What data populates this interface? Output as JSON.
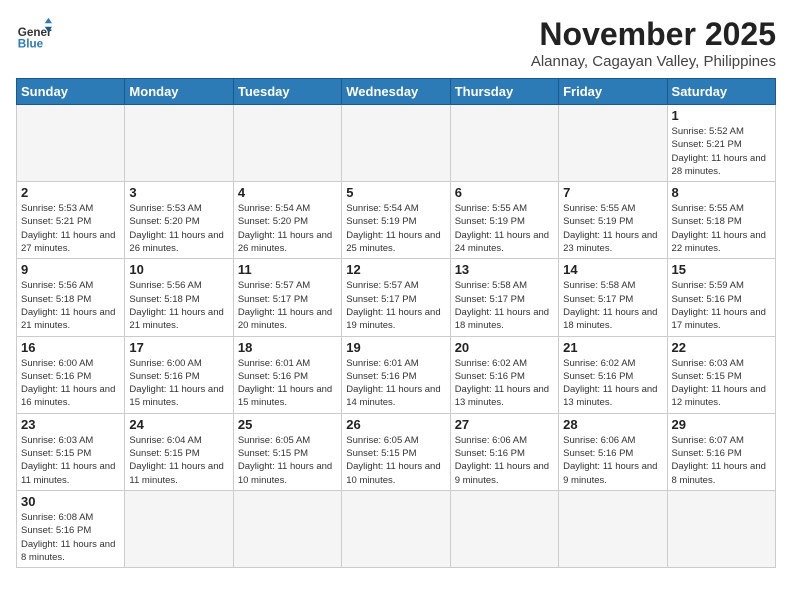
{
  "header": {
    "logo_general": "General",
    "logo_blue": "Blue",
    "month_title": "November 2025",
    "location": "Alannay, Cagayan Valley, Philippines"
  },
  "weekdays": [
    "Sunday",
    "Monday",
    "Tuesday",
    "Wednesday",
    "Thursday",
    "Friday",
    "Saturday"
  ],
  "days": {
    "1": {
      "sunrise": "5:52 AM",
      "sunset": "5:21 PM",
      "daylight": "11 hours and 28 minutes."
    },
    "2": {
      "sunrise": "5:53 AM",
      "sunset": "5:21 PM",
      "daylight": "11 hours and 27 minutes."
    },
    "3": {
      "sunrise": "5:53 AM",
      "sunset": "5:20 PM",
      "daylight": "11 hours and 26 minutes."
    },
    "4": {
      "sunrise": "5:54 AM",
      "sunset": "5:20 PM",
      "daylight": "11 hours and 26 minutes."
    },
    "5": {
      "sunrise": "5:54 AM",
      "sunset": "5:19 PM",
      "daylight": "11 hours and 25 minutes."
    },
    "6": {
      "sunrise": "5:55 AM",
      "sunset": "5:19 PM",
      "daylight": "11 hours and 24 minutes."
    },
    "7": {
      "sunrise": "5:55 AM",
      "sunset": "5:19 PM",
      "daylight": "11 hours and 23 minutes."
    },
    "8": {
      "sunrise": "5:55 AM",
      "sunset": "5:18 PM",
      "daylight": "11 hours and 22 minutes."
    },
    "9": {
      "sunrise": "5:56 AM",
      "sunset": "5:18 PM",
      "daylight": "11 hours and 21 minutes."
    },
    "10": {
      "sunrise": "5:56 AM",
      "sunset": "5:18 PM",
      "daylight": "11 hours and 21 minutes."
    },
    "11": {
      "sunrise": "5:57 AM",
      "sunset": "5:17 PM",
      "daylight": "11 hours and 20 minutes."
    },
    "12": {
      "sunrise": "5:57 AM",
      "sunset": "5:17 PM",
      "daylight": "11 hours and 19 minutes."
    },
    "13": {
      "sunrise": "5:58 AM",
      "sunset": "5:17 PM",
      "daylight": "11 hours and 18 minutes."
    },
    "14": {
      "sunrise": "5:58 AM",
      "sunset": "5:17 PM",
      "daylight": "11 hours and 18 minutes."
    },
    "15": {
      "sunrise": "5:59 AM",
      "sunset": "5:16 PM",
      "daylight": "11 hours and 17 minutes."
    },
    "16": {
      "sunrise": "6:00 AM",
      "sunset": "5:16 PM",
      "daylight": "11 hours and 16 minutes."
    },
    "17": {
      "sunrise": "6:00 AM",
      "sunset": "5:16 PM",
      "daylight": "11 hours and 15 minutes."
    },
    "18": {
      "sunrise": "6:01 AM",
      "sunset": "5:16 PM",
      "daylight": "11 hours and 15 minutes."
    },
    "19": {
      "sunrise": "6:01 AM",
      "sunset": "5:16 PM",
      "daylight": "11 hours and 14 minutes."
    },
    "20": {
      "sunrise": "6:02 AM",
      "sunset": "5:16 PM",
      "daylight": "11 hours and 13 minutes."
    },
    "21": {
      "sunrise": "6:02 AM",
      "sunset": "5:16 PM",
      "daylight": "11 hours and 13 minutes."
    },
    "22": {
      "sunrise": "6:03 AM",
      "sunset": "5:15 PM",
      "daylight": "11 hours and 12 minutes."
    },
    "23": {
      "sunrise": "6:03 AM",
      "sunset": "5:15 PM",
      "daylight": "11 hours and 11 minutes."
    },
    "24": {
      "sunrise": "6:04 AM",
      "sunset": "5:15 PM",
      "daylight": "11 hours and 11 minutes."
    },
    "25": {
      "sunrise": "6:05 AM",
      "sunset": "5:15 PM",
      "daylight": "11 hours and 10 minutes."
    },
    "26": {
      "sunrise": "6:05 AM",
      "sunset": "5:15 PM",
      "daylight": "11 hours and 10 minutes."
    },
    "27": {
      "sunrise": "6:06 AM",
      "sunset": "5:16 PM",
      "daylight": "11 hours and 9 minutes."
    },
    "28": {
      "sunrise": "6:06 AM",
      "sunset": "5:16 PM",
      "daylight": "11 hours and 9 minutes."
    },
    "29": {
      "sunrise": "6:07 AM",
      "sunset": "5:16 PM",
      "daylight": "11 hours and 8 minutes."
    },
    "30": {
      "sunrise": "6:08 AM",
      "sunset": "5:16 PM",
      "daylight": "11 hours and 8 minutes."
    }
  }
}
